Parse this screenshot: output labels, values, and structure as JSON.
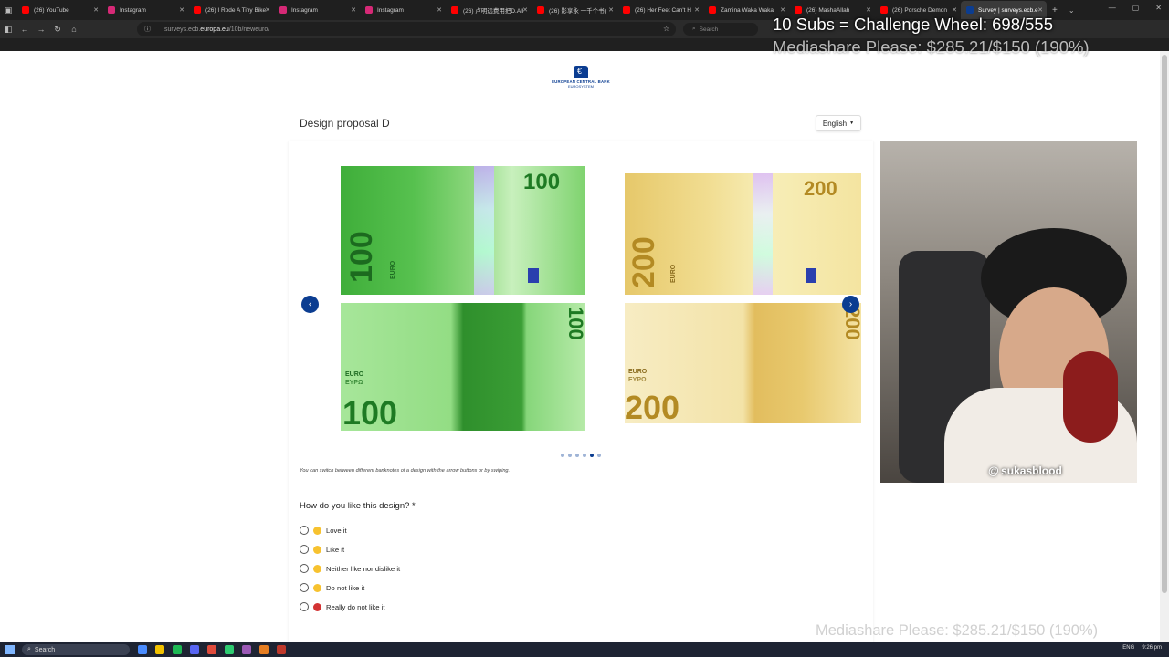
{
  "browser": {
    "tabs": [
      {
        "label": "(26) YouTube",
        "color": "#ff0000"
      },
      {
        "label": "Instagram",
        "color": "#d62976"
      },
      {
        "label": "(26) I Rode A Tiny Bike F",
        "color": "#ff0000"
      },
      {
        "label": "Instagram",
        "color": "#d62976"
      },
      {
        "label": "Instagram",
        "color": "#d62976"
      },
      {
        "label": "(26) 卢明远费用把D.All",
        "color": "#ff0000"
      },
      {
        "label": "(26) 影享永 一千个书(",
        "color": "#ff0000"
      },
      {
        "label": "(26) Her Feet Can't H",
        "color": "#ff0000"
      },
      {
        "label": "Zamina Waka Waka",
        "color": "#ff0000"
      },
      {
        "label": "(26) MashaAllah",
        "color": "#ff0000"
      },
      {
        "label": "(26) Porsche Demon",
        "color": "#ff0000"
      },
      {
        "label": "Survey | surveys.ecb.eu",
        "color": "#0b3d91",
        "active": true
      }
    ],
    "url_prefix": "surveys.ecb.",
    "url_host": "europa.eu",
    "url_path": "/10b/neweuro/",
    "search_placeholder": "Search"
  },
  "page": {
    "logo_line1": "EUROPEAN CENTRAL BANK",
    "logo_line2": "EUROSYSTEM",
    "title": "Design proposal D",
    "language": "English",
    "hint": "You can switch between different banknotes of a design with the arrow buttons or by swiping.",
    "question": "How do you like this design? *",
    "options": [
      {
        "label": "Love it",
        "emoji": "#f7c22f"
      },
      {
        "label": "Like it",
        "emoji": "#f7c22f"
      },
      {
        "label": "Neither like nor dislike it",
        "emoji": "#f7c22f"
      },
      {
        "label": "Do not like it",
        "emoji": "#f7c22f"
      },
      {
        "label": "Really do not like it",
        "emoji": "#d33333"
      }
    ],
    "carousel_dots": 6,
    "carousel_active_dot": 4,
    "notes": {
      "n100_front_value": "100",
      "n100_front_corner": "100",
      "n100_back_value": "100",
      "n100_back_corner": "100",
      "n200_front_value": "200",
      "n200_front_corner": "200",
      "n200_back_value": "200",
      "n200_back_corner": "200",
      "euro_latin": "EURO",
      "euro_greek": "ΕΥΡΩ"
    }
  },
  "overlays": {
    "subs": "10 Subs = Challenge Wheel: 698/555",
    "mediashare": "Mediashare Please: $285.21/$150 (190%)",
    "mediashare_bottom": "Mediashare Please: $285.21/$150 (190%)",
    "webcam_handle": "@ sukasblood"
  },
  "taskbar": {
    "search": "Search",
    "lang": "ENG",
    "time": "9:26 pm"
  }
}
